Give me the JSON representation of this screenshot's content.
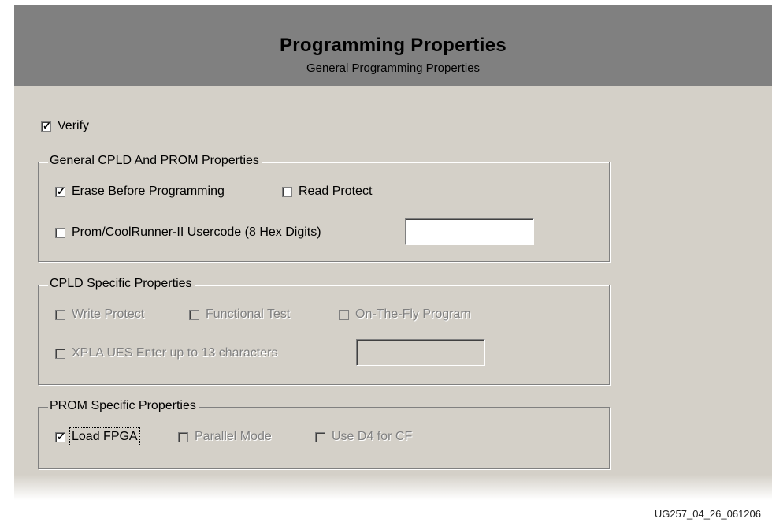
{
  "header": {
    "title": "Programming Properties",
    "subtitle": "General Programming Properties"
  },
  "verify": {
    "label": "Verify",
    "checked": true
  },
  "general_group": {
    "title": "General CPLD And PROM Properties",
    "items": [
      {
        "label": "Erase Before Programming",
        "checked": true
      },
      {
        "label": "Read Protect",
        "checked": false
      },
      {
        "label": "Prom/CoolRunner-II Usercode (8 Hex Digits)",
        "checked": false
      }
    ],
    "usercode_value": ""
  },
  "cpld_group": {
    "title": "CPLD Specific Properties",
    "items": [
      {
        "label": "Write Protect",
        "checked": false,
        "enabled": false
      },
      {
        "label": "Functional Test",
        "checked": false,
        "enabled": false
      },
      {
        "label": "On-The-Fly Program",
        "checked": false,
        "enabled": false
      },
      {
        "label": "XPLA UES Enter up to 13 characters",
        "checked": false,
        "enabled": false
      }
    ],
    "ues_value": ""
  },
  "prom_group": {
    "title": "PROM Specific Properties",
    "items": [
      {
        "label": "Load FPGA",
        "checked": true,
        "enabled": true
      },
      {
        "label": "Parallel Mode",
        "checked": false,
        "enabled": false
      },
      {
        "label": "Use D4 for CF",
        "checked": false,
        "enabled": false
      }
    ]
  },
  "figure_id": "UG257_04_26_061206",
  "check_glyph": "✓"
}
